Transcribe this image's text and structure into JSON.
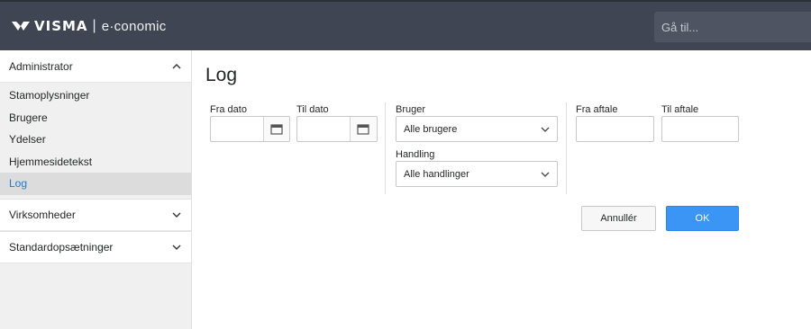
{
  "header": {
    "brand": "VISMA",
    "separator": "|",
    "product": "e·conomic",
    "goto_placeholder": "Gå til..."
  },
  "sidebar": {
    "admin_label": "Administrator",
    "items": [
      {
        "label": "Stamoplysninger"
      },
      {
        "label": "Brugere"
      },
      {
        "label": "Ydelser"
      },
      {
        "label": "Hjemmesidetekst"
      },
      {
        "label": "Log",
        "active": true
      }
    ],
    "groups": [
      {
        "label": "Virksomheder"
      },
      {
        "label": "Standardopsætninger"
      }
    ]
  },
  "main": {
    "title": "Log",
    "from_date_label": "Fra dato",
    "to_date_label": "Til dato",
    "user_label": "Bruger",
    "user_value": "Alle brugere",
    "action_label": "Handling",
    "action_value": "Alle handlinger",
    "from_agreement_label": "Fra aftale",
    "to_agreement_label": "Til aftale",
    "cancel_label": "Annullér",
    "ok_label": "OK"
  },
  "colors": {
    "header_bg": "#3f4552",
    "accent": "#3b95f5",
    "active_link": "#1b7bd6",
    "sidebar_bg": "#f0f0f0"
  }
}
